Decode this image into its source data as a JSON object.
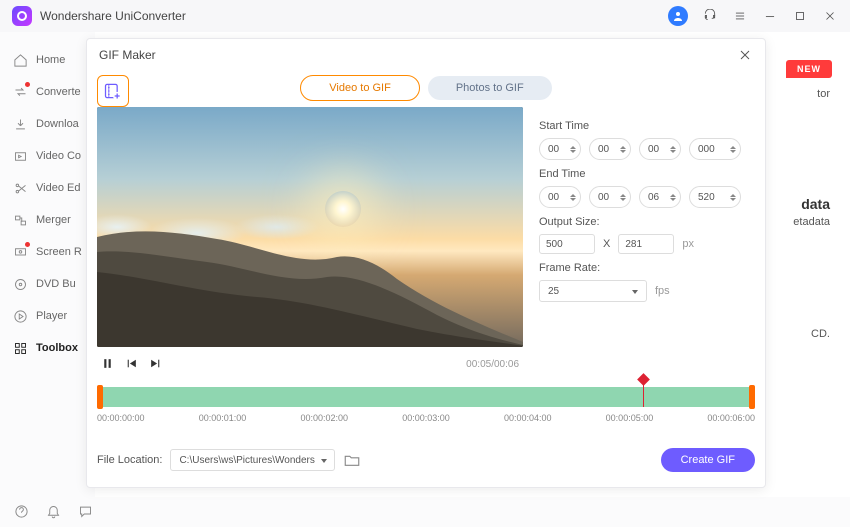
{
  "app": {
    "title": "Wondershare UniConverter"
  },
  "sidebar": {
    "items": [
      {
        "label": "Home"
      },
      {
        "label": "Converte"
      },
      {
        "label": "Downloa"
      },
      {
        "label": "Video Co"
      },
      {
        "label": "Video Ed"
      },
      {
        "label": "Merger"
      },
      {
        "label": "Screen R"
      },
      {
        "label": "DVD Bu"
      },
      {
        "label": "Player"
      },
      {
        "label": "Toolbox"
      }
    ]
  },
  "mainbg": {
    "new": "NEW",
    "peek1": "tor",
    "peek2": "data",
    "peek3": "etadata",
    "peek4": "CD."
  },
  "modal": {
    "title": "GIF Maker",
    "tabs": {
      "video": "Video to GIF",
      "photos": "Photos to GIF"
    },
    "start_label": "Start Time",
    "end_label": "End Time",
    "output_label": "Output Size:",
    "frame_label": "Frame Rate:",
    "start": {
      "h": "00",
      "m": "00",
      "s": "00",
      "ms": "000"
    },
    "end": {
      "h": "00",
      "m": "00",
      "s": "06",
      "ms": "520"
    },
    "output": {
      "w": "500",
      "h": "281",
      "x": "X",
      "unit": "px"
    },
    "framerate": {
      "value": "25",
      "unit": "fps"
    },
    "playtime": "00:05/00:06",
    "ruler": [
      "00:00:00:00",
      "00:00:01:00",
      "00:00:02:00",
      "00:00:03:00",
      "00:00:04:00",
      "00:00:05:00",
      "00:00:06:00"
    ]
  },
  "footer": {
    "label": "File Location:",
    "path": "C:\\Users\\ws\\Pictures\\Wonders",
    "create": "Create GIF"
  }
}
